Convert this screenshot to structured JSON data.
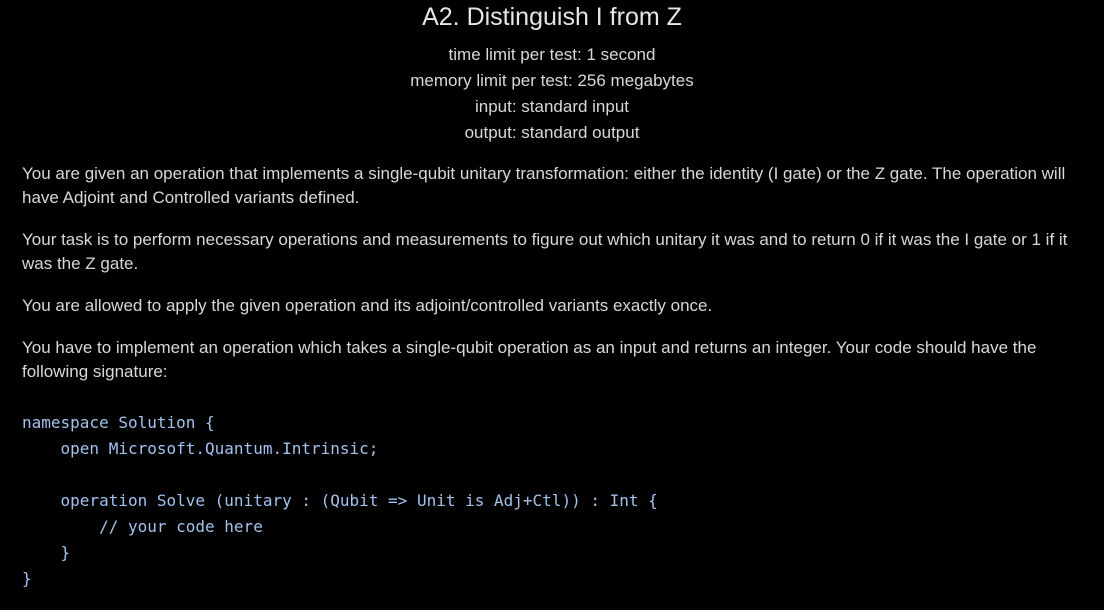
{
  "problem": {
    "title": "A2. Distinguish I from Z",
    "time_limit": "time limit per test: 1 second",
    "memory_limit": "memory limit per test: 256 megabytes",
    "input": "input: standard input",
    "output": "output: standard output"
  },
  "statement": {
    "paragraphs": [
      "You are given an operation that implements a single-qubit unitary transformation: either the identity (I gate) or the Z gate. The operation will have Adjoint and Controlled variants defined.",
      "Your task is to perform necessary operations and measurements to figure out which unitary it was and to return 0 if it was the I gate or 1 if it was the Z gate.",
      "You are allowed to apply the given operation and its adjoint/controlled variants exactly once.",
      "You have to implement an operation which takes a single-qubit operation as an input and returns an integer. Your code should have the following signature:"
    ]
  },
  "code": {
    "lines": [
      "namespace Solution {",
      "    open Microsoft.Quantum.Intrinsic;",
      "",
      "    operation Solve (unitary : (Qubit => Unit is Adj+Ctl)) : Int {",
      "        // your code here",
      "    }",
      "}"
    ]
  },
  "colors": {
    "background": "#000000",
    "text": "#d8d8d8",
    "code_text": "#9fc3ef"
  }
}
